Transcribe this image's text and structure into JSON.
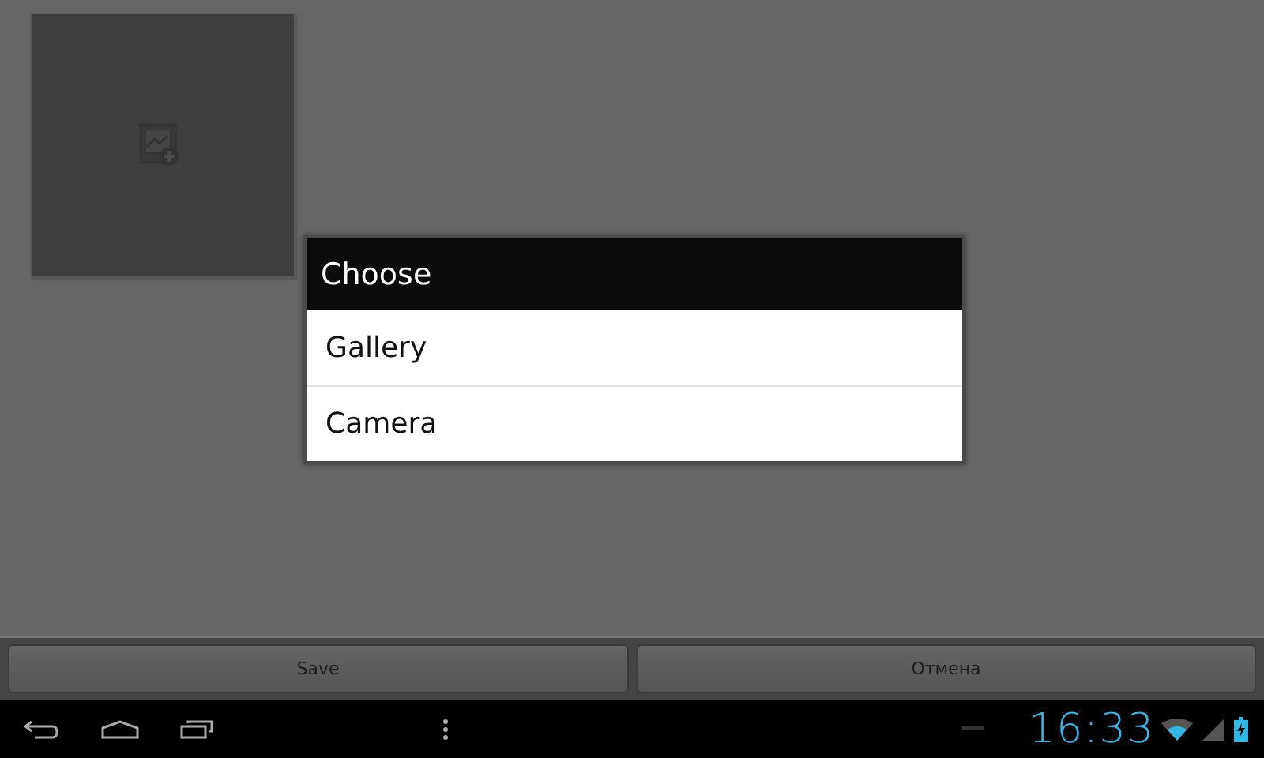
{
  "image_slot": {
    "kind": "placeholder"
  },
  "dialog": {
    "title": "Choose",
    "options": [
      "Gallery",
      "Camera"
    ]
  },
  "buttons": [
    "Save",
    "Отмена"
  ],
  "status_bar": {
    "time": "16:33"
  }
}
